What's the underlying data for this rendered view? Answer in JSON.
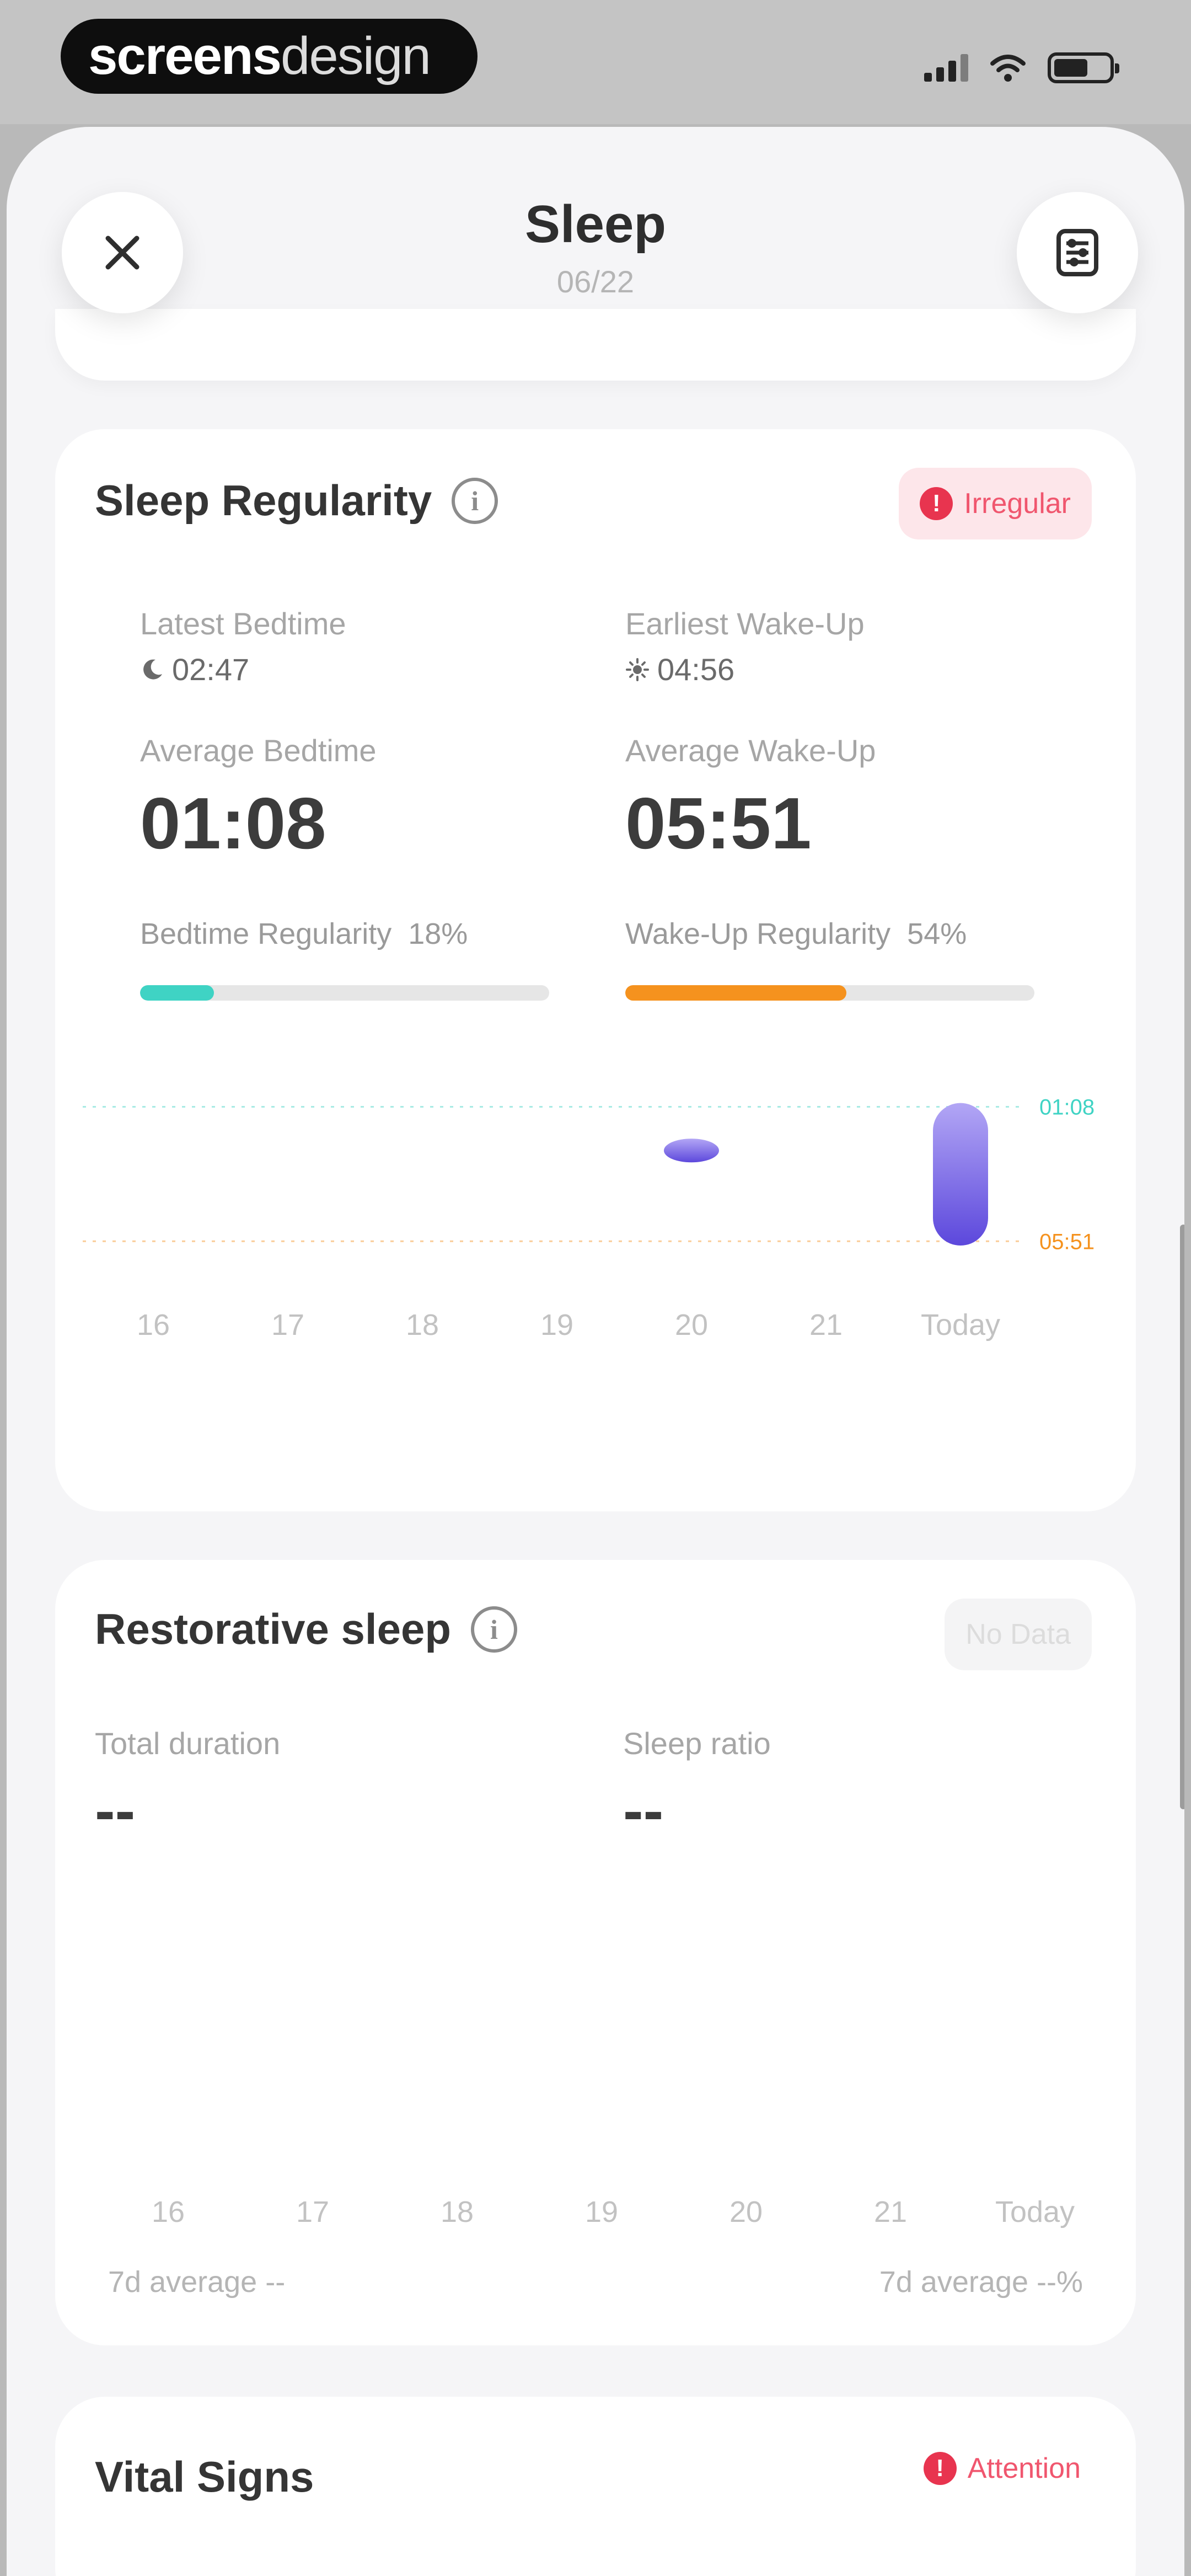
{
  "status_bar": {
    "brand_bold": "screens",
    "brand_light": "design"
  },
  "header": {
    "title": "Sleep",
    "date": "06/22"
  },
  "regularity": {
    "title": "Sleep Regularity",
    "badge": "Irregular",
    "latest_bedtime_label": "Latest Bedtime",
    "latest_bedtime": "02:47",
    "earliest_wakeup_label": "Earliest Wake-Up",
    "earliest_wakeup": "04:56",
    "avg_bedtime_label": "Average Bedtime",
    "avg_bedtime": "01:08",
    "avg_wakeup_label": "Average Wake-Up",
    "avg_wakeup": "05:51",
    "bedtime_reg_label": "Bedtime Regularity",
    "bedtime_reg_value": "18%",
    "bedtime_reg_pct": 18,
    "wakeup_reg_label": "Wake-Up Regularity",
    "wakeup_reg_value": "54%",
    "wakeup_reg_pct": 54,
    "colors": {
      "bedtime": "#3fd3c4",
      "wakeup": "#f5921e",
      "bar_top": "#b2a6f5",
      "bar_bottom": "#5c48dc"
    }
  },
  "chart_data": {
    "type": "bar",
    "categories": [
      "16",
      "17",
      "18",
      "19",
      "20",
      "21",
      "Today"
    ],
    "series": [
      {
        "start": [
          null,
          null,
          null,
          null,
          "02:15",
          null,
          "01:00"
        ],
        "end": [
          null,
          null,
          null,
          null,
          "03:05",
          null,
          "06:00"
        ]
      }
    ],
    "reference_lines": [
      {
        "label": "01:08",
        "value": "01:08",
        "color": "#3fd3c4"
      },
      {
        "label": "05:51",
        "value": "05:51",
        "color": "#f5921e"
      }
    ]
  },
  "restorative": {
    "title": "Restorative sleep",
    "badge": "No Data",
    "total_label": "Total duration",
    "total_value": "--",
    "ratio_label": "Sleep ratio",
    "ratio_value": "--",
    "x_labels": [
      "16",
      "17",
      "18",
      "19",
      "20",
      "21",
      "Today"
    ],
    "avg_left": "7d average --",
    "avg_right": "7d average --%"
  },
  "vitals": {
    "title": "Vital Signs",
    "badge": "Attention"
  }
}
